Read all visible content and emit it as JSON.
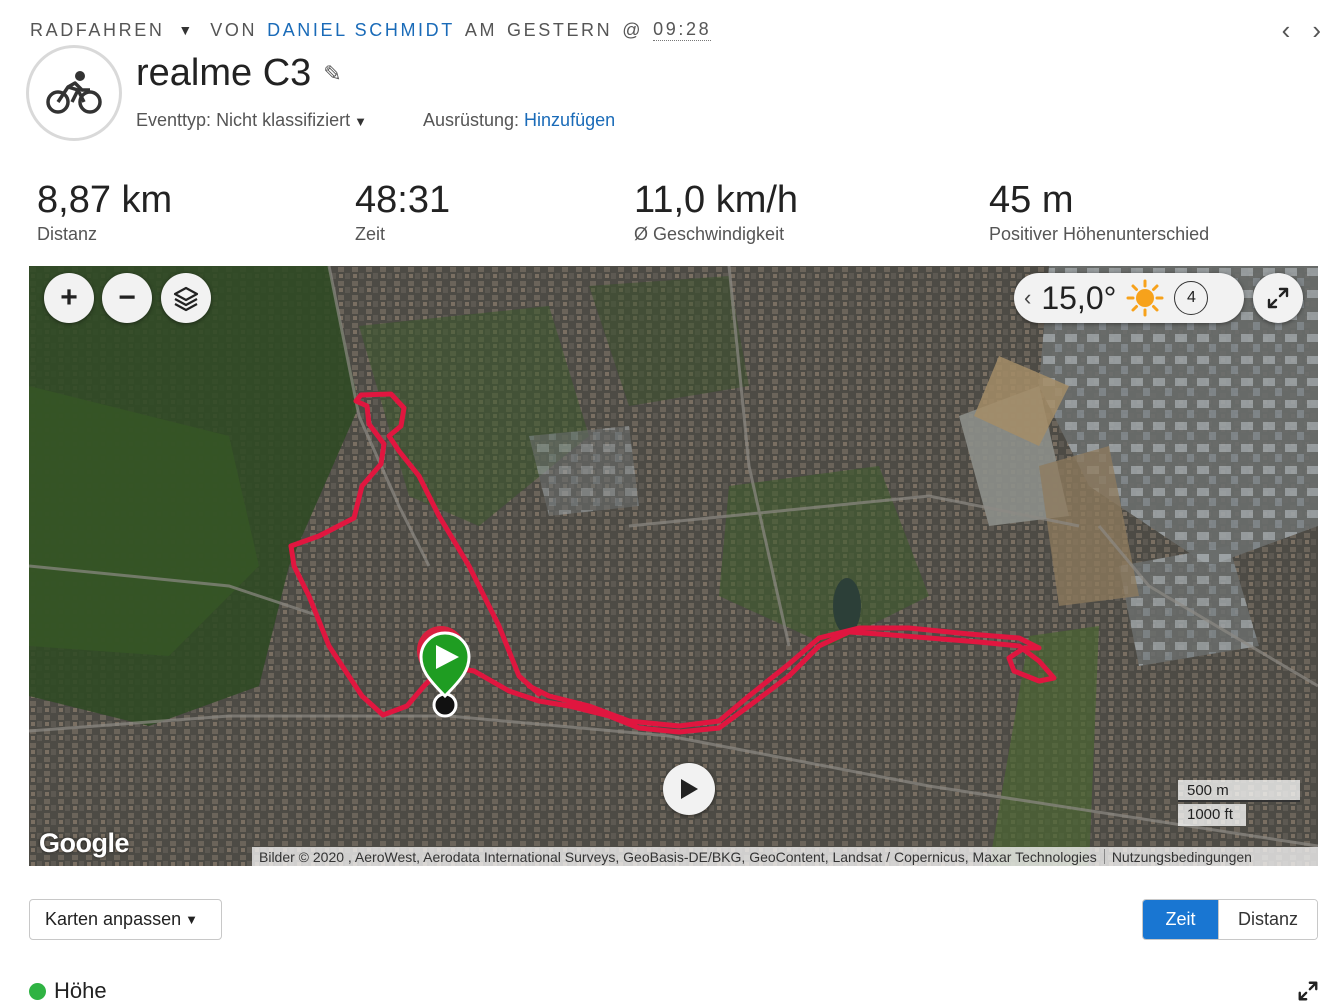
{
  "header": {
    "activity_type": "Radfahren",
    "by_label": "von",
    "user_name": "Daniel Schmidt",
    "on_label": "am",
    "day": "gestern",
    "at_label": "@",
    "time": "09:28",
    "prev_icon": "chevron-left-icon",
    "next_icon": "chevron-right-icon"
  },
  "activity": {
    "icon": "bicycle-icon",
    "title": "realme C3",
    "event_type_label": "Eventtyp:",
    "event_type_value": "Nicht klassifiziert",
    "equipment_label": "Ausrüstung:",
    "equipment_link": "Hinzufügen"
  },
  "stats": [
    {
      "value": "8,87 km",
      "label": "Distanz"
    },
    {
      "value": "48:31",
      "label": "Zeit"
    },
    {
      "value": "11,0 km/h",
      "label": "Ø Geschwindigkeit"
    },
    {
      "value": "45 m",
      "label": "Positiver Höhenunterschied"
    }
  ],
  "map": {
    "zoom_in": "+",
    "zoom_out": "−",
    "temperature": "15,0°",
    "wind": "4",
    "scale_metric": "500 m",
    "scale_imperial": "1000 ft",
    "logo": "Google",
    "attribution": "Bilder © 2020 , AeroWest, Aerodata International Surveys, GeoBasis-DE/BKG, GeoContent, Landsat / Copernicus, Maxar Technologies",
    "terms": "Nutzungsbedingungen",
    "route_color": "#e0163f"
  },
  "controls": {
    "adjust_maps": "Karten anpassen",
    "toggle_time": "Zeit",
    "toggle_distance": "Distanz"
  },
  "chart": {
    "legend": "Höhe",
    "legend_color": "#2fb343"
  }
}
